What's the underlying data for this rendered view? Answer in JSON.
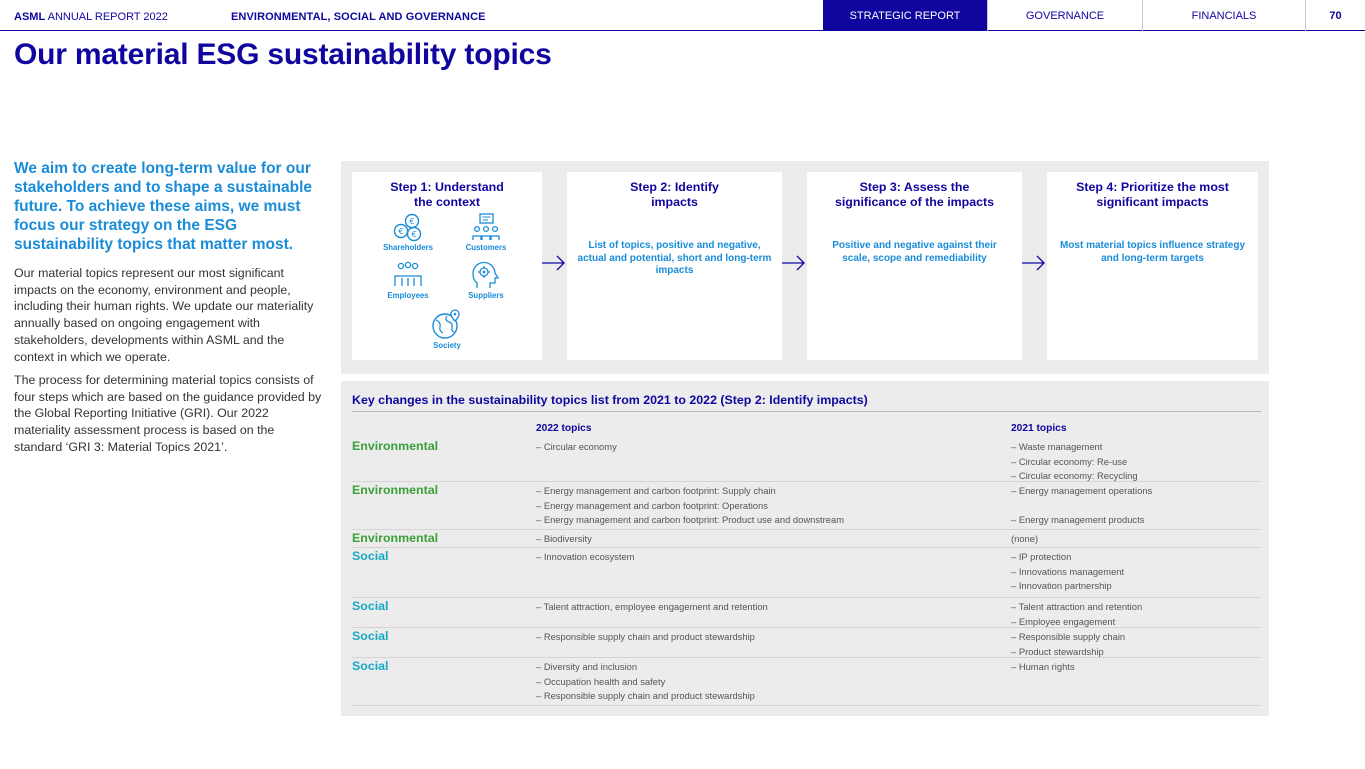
{
  "header": {
    "brand_bold": "ASML",
    "brand_rest": " ANNUAL REPORT 2022",
    "section": "ENVIRONMENTAL, SOCIAL AND GOVERNANCE",
    "tabs": [
      "STRATEGIC REPORT",
      "GOVERNANCE",
      "FINANCIALS"
    ],
    "page_number": "70"
  },
  "title": "Our material ESG sustainability topics",
  "intro": {
    "lead": "We aim to create long-term value for our stakeholders and to shape a sustainable future. To achieve these aims, we must focus our strategy on the ESG sustainability topics that matter most.",
    "p1": "Our material topics represent our most significant impacts on the economy, environment and people, including their human rights. We update our materiality annually based on ongoing engagement with stakeholders, developments within ASML and the context in which we operate.",
    "p2": "The process for determining material topics consists of four steps which are based on the guidance provided by the Global Reporting Initiative (GRI). Our 2022 materiality assessment process is based on the standard ‘GRI 3: Material Topics 2021’."
  },
  "steps": [
    {
      "title_l1": "Step 1: Understand",
      "title_l2": "the context",
      "desc": ""
    },
    {
      "title_l1": "Step 2: Identify",
      "title_l2": "impacts",
      "desc": "List of topics, positive and negative, actual and potential, short and long-term impacts"
    },
    {
      "title_l1": "Step 3: Assess the",
      "title_l2": "significance of the impacts",
      "desc": "Positive and negative against their scale, scope and remediability"
    },
    {
      "title_l1": "Step 4: Prioritize the most",
      "title_l2": "significant impacts",
      "desc": "Most material topics influence strategy and long-term targets"
    }
  ],
  "stakeholders": {
    "shareholders": {
      "label": "Shareholders",
      "icon": "euro-coins-icon"
    },
    "customers": {
      "label": "Customers",
      "icon": "customers-icon"
    },
    "employees": {
      "label": "Employees",
      "icon": "employees-icon"
    },
    "suppliers": {
      "label": "Suppliers",
      "icon": "supplier-gear-icon"
    },
    "society": {
      "label": "Society",
      "icon": "globe-icon"
    }
  },
  "changes": {
    "title": "Key changes in the sustainability topics list from 2021 to 2022 (Step 2: Identify impacts)",
    "col_2022": "2022 topics",
    "col_2021": "2021 topics",
    "rows": [
      {
        "category": "Environmental",
        "t2022": [
          "– Circular economy"
        ],
        "t2021": [
          "– Waste management",
          "– Circular economy: Re-use",
          "– Circular economy: Recycling"
        ]
      },
      {
        "category": "Environmental",
        "t2022": [
          "– Energy management and carbon footprint: Supply chain",
          "– Energy management and carbon footprint: Operations",
          "– Energy management and carbon footprint: Product use and downstream"
        ],
        "t2021": [
          "– Energy management operations",
          "",
          "– Energy management products"
        ]
      },
      {
        "category": "Environmental",
        "t2022": [
          "– Biodiversity"
        ],
        "t2021": [
          "(none)"
        ]
      },
      {
        "category": "Social",
        "t2022": [
          "– Innovation ecosystem"
        ],
        "t2021": [
          "– IP protection",
          "– Innovations management",
          "– Innovation partnership"
        ]
      },
      {
        "category": "Social",
        "t2022": [
          "– Talent attraction, employee engagement and retention"
        ],
        "t2021": [
          "– Talent attraction and retention",
          "– Employee engagement"
        ]
      },
      {
        "category": "Social",
        "t2022": [
          "– Responsible supply chain and product stewardship"
        ],
        "t2021": [
          "– Responsible supply chain",
          "– Product stewardship"
        ]
      },
      {
        "category": "Social",
        "t2022": [
          "– Diversity and inclusion",
          "– Occupation health and safety",
          "– Responsible supply chain and product stewardship"
        ],
        "t2021": [
          "– Human rights"
        ]
      }
    ]
  },
  "colors": {
    "navy": "#10069f",
    "light_blue": "#1a8cd8",
    "environmental": "#3aa03a",
    "social": "#17a9c4",
    "panel_bg": "#ececec"
  }
}
